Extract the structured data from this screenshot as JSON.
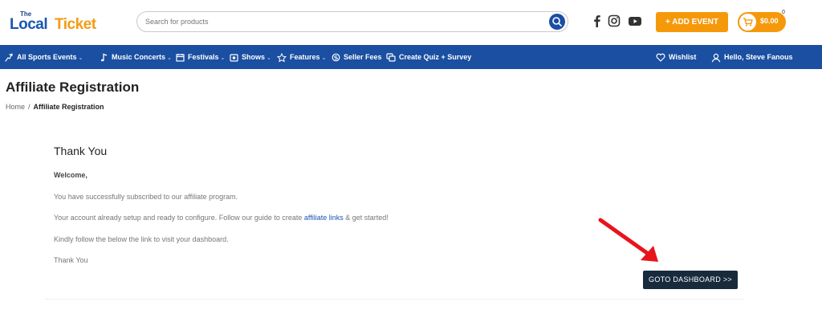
{
  "brand": {
    "the": "The",
    "local": "Local",
    "ticket": "Ticket"
  },
  "search": {
    "placeholder": "Search for products"
  },
  "social": [
    "facebook-icon",
    "instagram-icon",
    "youtube-icon"
  ],
  "header": {
    "add_event": "+ ADD EVENT",
    "cart_amount": "$0.00",
    "cart_count": "0"
  },
  "nav": {
    "items": [
      {
        "label": "All Sports Events",
        "icon": "sports-icon",
        "dropdown": true
      },
      {
        "label": "Music Concerts",
        "icon": "music-note-icon",
        "dropdown": true
      },
      {
        "label": "Festivals",
        "icon": "festival-icon",
        "dropdown": true
      },
      {
        "label": "Shows",
        "icon": "shows-icon",
        "dropdown": true
      },
      {
        "label": "Features",
        "icon": "star-icon",
        "dropdown": true
      },
      {
        "label": "Seller Fees",
        "icon": "fees-icon",
        "dropdown": false
      },
      {
        "label": "Create Quiz + Survey",
        "icon": "quiz-icon",
        "dropdown": false
      }
    ],
    "wishlist": "Wishlist",
    "user": "Hello, Steve Fanous",
    "chevron": "⌄"
  },
  "page": {
    "title": "Affiliate Registration"
  },
  "breadcrumb": {
    "home": "Home",
    "separator": "/",
    "current": "Affiliate Registration"
  },
  "content": {
    "heading": "Thank You",
    "welcome": "Welcome,",
    "line1": "You have successfully subscribed to our affiliate program.",
    "line2_before": "Your account already setup and ready to configure. Follow our guide to create ",
    "line2_link": "affiliate links",
    "line2_after": " & get started!",
    "line3": "Kindly follow the below the link to visit your dashboard.",
    "signoff": "Thank You",
    "button": "GOTO DASHBOARD >>"
  },
  "colors": {
    "brand_blue": "#1a4fa1",
    "accent_orange": "#f5990b",
    "button_dark": "#172b3d",
    "arrow_red": "#e8141b"
  }
}
